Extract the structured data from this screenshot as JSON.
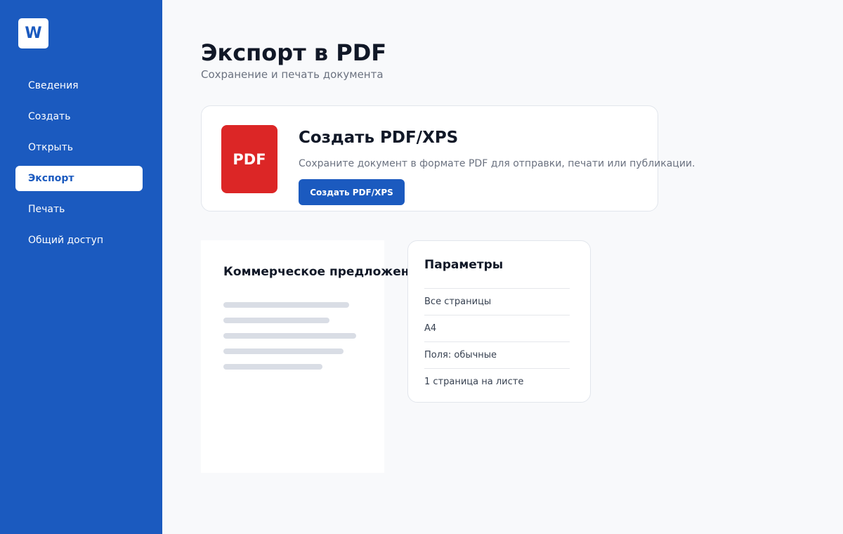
{
  "app": {
    "logo_letter": "W"
  },
  "sidebar": {
    "items": [
      {
        "label": "Сведения",
        "active": false
      },
      {
        "label": "Создать",
        "active": false
      },
      {
        "label": "Открыть",
        "active": false
      },
      {
        "label": "Экспорт",
        "active": true
      },
      {
        "label": "Печать",
        "active": false
      },
      {
        "label": "Общий доступ",
        "active": false
      }
    ]
  },
  "header": {
    "title": "Экспорт в PDF",
    "subtitle": "Сохранение и печать документа"
  },
  "export_card": {
    "icon_label": "PDF",
    "title": "Создать PDF/XPS",
    "description": "Сохраните документ в формате PDF для отправки, печати или публикации.",
    "button_label": "Создать PDF/XPS"
  },
  "preview": {
    "doc_title": "Коммерческое предложение"
  },
  "params": {
    "title": "Параметры",
    "rows": [
      "Все страницы",
      "A4",
      "Поля: обычные",
      "1 страница на листе"
    ]
  },
  "colors": {
    "brand": "#1b5abf",
    "pdf_red": "#dc2626",
    "page_bg": "#f8f9fb"
  }
}
